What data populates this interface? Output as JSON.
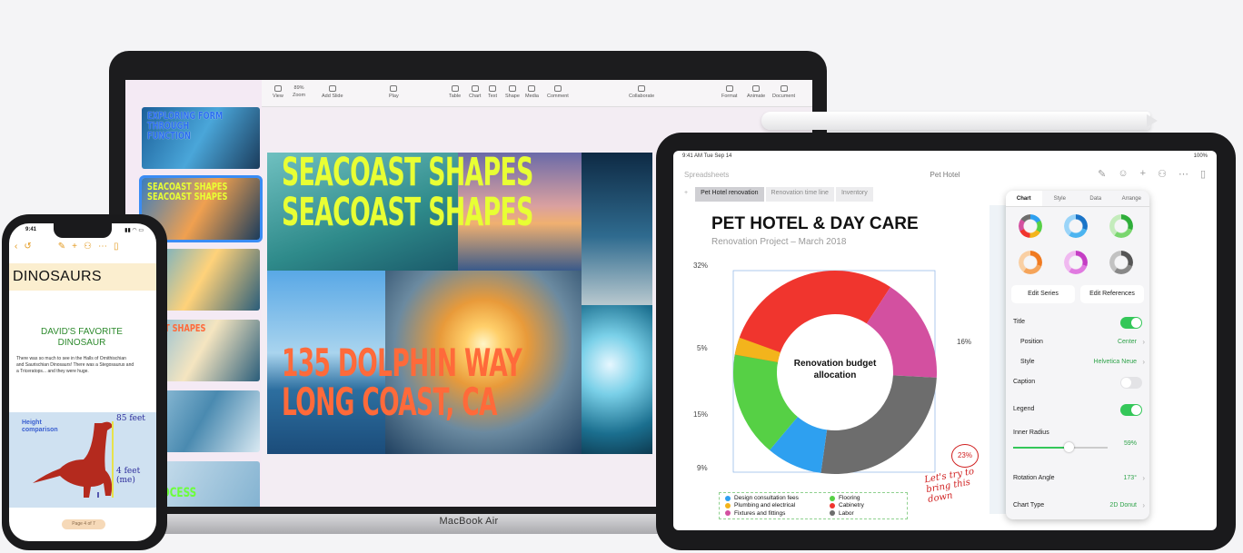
{
  "macbook": {
    "brand": "MacBook Air",
    "keynote": {
      "toolbar": [
        {
          "label": "View",
          "icon": "view-icon"
        },
        {
          "label": "Zoom",
          "icon": "zoom-icon",
          "value": "89%"
        },
        {
          "label": "Add Slide",
          "icon": "add-slide-icon"
        },
        {
          "label": "Play",
          "icon": "play-icon"
        },
        {
          "label": "Table",
          "icon": "table-icon"
        },
        {
          "label": "Chart",
          "icon": "chart-icon"
        },
        {
          "label": "Text",
          "icon": "text-icon"
        },
        {
          "label": "Shape",
          "icon": "shape-icon"
        },
        {
          "label": "Media",
          "icon": "media-icon"
        },
        {
          "label": "Comment",
          "icon": "comment-icon"
        },
        {
          "label": "Collaborate",
          "icon": "collaborate-icon"
        },
        {
          "label": "Format",
          "icon": "format-icon"
        },
        {
          "label": "Animate",
          "icon": "animate-icon"
        },
        {
          "label": "Document",
          "icon": "document-icon"
        }
      ],
      "slides": [
        {
          "title": "EXPLORING FORM THROUGH FUNCTION",
          "color": "#1a6fd0"
        },
        {
          "title": "SEACOAST SHAPES SEACOAST SHAPES",
          "color": "#e8ff34"
        },
        {
          "title": "",
          "color": "#e8ff34"
        },
        {
          "title": "OAST SHAPES",
          "color": "#ff6a3a"
        },
        {
          "title": "",
          "color": "#ffffff"
        },
        {
          "title": "",
          "color": "#ffffff"
        },
        {
          "title": "PROCESS",
          "color": "#6cff3a"
        }
      ],
      "canvas": {
        "headline_1": "SEACOAST SHAPES",
        "headline_2": "SEACOAST SHAPES",
        "address_1": "135 DOLPHIN WAY",
        "address_2": "LONG COAST, CA"
      }
    }
  },
  "ipad": {
    "status_time": "9:41 AM   Tue Sep 14",
    "status_battery": "100%",
    "back": "Spreadsheets",
    "doc_title": "Pet Hotel",
    "toolbar_icons": [
      "paintbrush-icon",
      "smiley-icon",
      "plus-icon",
      "collaborate-icon",
      "more-icon",
      "document-icon"
    ],
    "tabs": [
      "Pet Hotel renovation",
      "Renovation time line",
      "Inventory"
    ],
    "sheet": {
      "title": "PET HOTEL & DAY CARE",
      "subtitle": "Renovation Project – March 2018",
      "donut_label": "Renovation budget allocation",
      "pct_labels": [
        "32%",
        "5%",
        "15%",
        "9%",
        "16%"
      ],
      "annotation_circle": "23%",
      "annotation_note": "Let's try to bring this down",
      "legend": [
        {
          "label": "Design consultation fees",
          "color": "#2ea0f0"
        },
        {
          "label": "Flooring",
          "color": "#56d045"
        },
        {
          "label": "Plumbing and electrical",
          "color": "#f3b41c"
        },
        {
          "label": "Cabinetry",
          "color": "#f0352e"
        },
        {
          "label": "Fixtures and fittings",
          "color": "#d350a0"
        },
        {
          "label": "Labor",
          "color": "#6d6d6d"
        }
      ]
    },
    "panel": {
      "tabs": [
        "Chart",
        "Style",
        "Data",
        "Arrange"
      ],
      "buttons": [
        "Edit Series",
        "Edit References"
      ],
      "rows": {
        "title": "Title",
        "position": "Position",
        "position_value": "Center",
        "style": "Style",
        "style_value": "Helvetica Neue",
        "caption": "Caption",
        "legend": "Legend",
        "inner_radius": "Inner Radius",
        "inner_radius_value": "59%",
        "rotation": "Rotation Angle",
        "rotation_value": "173°",
        "chart_type": "Chart Type",
        "chart_type_value": "2D Donut"
      },
      "inner_radius_fraction": 0.59
    }
  },
  "iphone": {
    "time": "9:41",
    "title": "DINOSAURS",
    "subtitle_1": "DAVID'S FAVORITE",
    "subtitle_2": "DINOSAUR",
    "body": "There was so much to see in the Halls of Ornithischian and Saurischian Dinosaurs! There was a Stegosaurus and a Triceratops... and they were huge.",
    "height_label_1": "Height",
    "height_label_2": "comparison",
    "measure_1": "85 feet",
    "measure_2": "4 feet (me)",
    "page_indicator": "Page 4 of 7"
  }
}
